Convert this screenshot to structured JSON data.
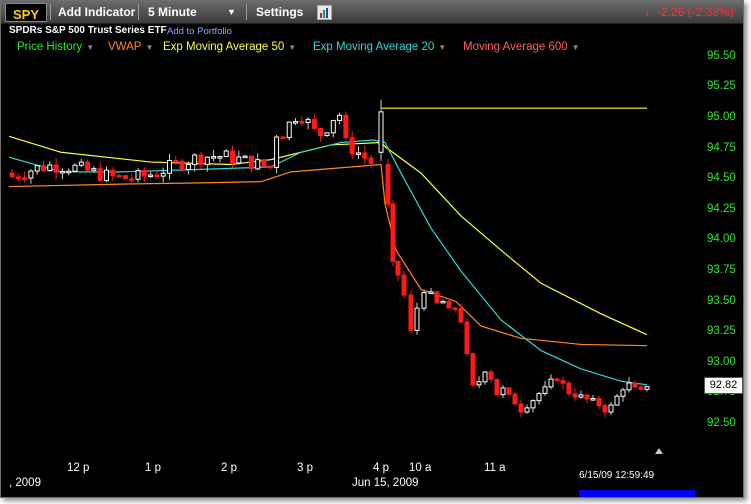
{
  "toolbar": {
    "symbol": "SPY",
    "add_indicator_label": "Add Indicator",
    "interval": "5 Minute",
    "settings_label": "Settings",
    "change_text": "-2.26 (-2.38%)"
  },
  "instrument": {
    "name": "SPDRs S&P 500 Trust Series ETF",
    "add_portfolio": "Add to Portfolio"
  },
  "legend": [
    {
      "label": "Price History",
      "color": "#22ee22"
    },
    {
      "label": "VWAP",
      "color": "#ff8a1a"
    },
    {
      "label": "Exp Moving Average 50",
      "color": "#ffff33"
    },
    {
      "label": "Exp Moving Average 20",
      "color": "#33d6d6"
    },
    {
      "label": "Moving Average 600",
      "color": "#ff6060"
    }
  ],
  "colors": {
    "up_candle": "#ffffff",
    "down_candle": "#ff1a1a",
    "axis_labels": "#2ee62e",
    "change": "#ff3030",
    "symbol": "#ffd200"
  },
  "y_axis": {
    "ticks": [
      "95.50",
      "95.25",
      "95.00",
      "94.75",
      "94.50",
      "94.25",
      "94.00",
      "93.75",
      "93.50",
      "93.25",
      "93.00",
      "92.75",
      "92.50"
    ],
    "last_price": "92.82"
  },
  "x_axis": {
    "ticks": [
      "12 p",
      "1 p",
      "2 p",
      "3 p",
      "4 p",
      "10 a",
      "11 a"
    ],
    "year": ", 2009",
    "date": "Jun 15, 2009"
  },
  "timestamp": "6/15/09 12:59:49",
  "chart_data": {
    "type": "candlestick",
    "ylim": [
      92.35,
      95.65
    ],
    "session_1": {
      "close_level": 94.62
    },
    "session_2": {
      "open": 94.3,
      "close": 92.82
    }
  }
}
